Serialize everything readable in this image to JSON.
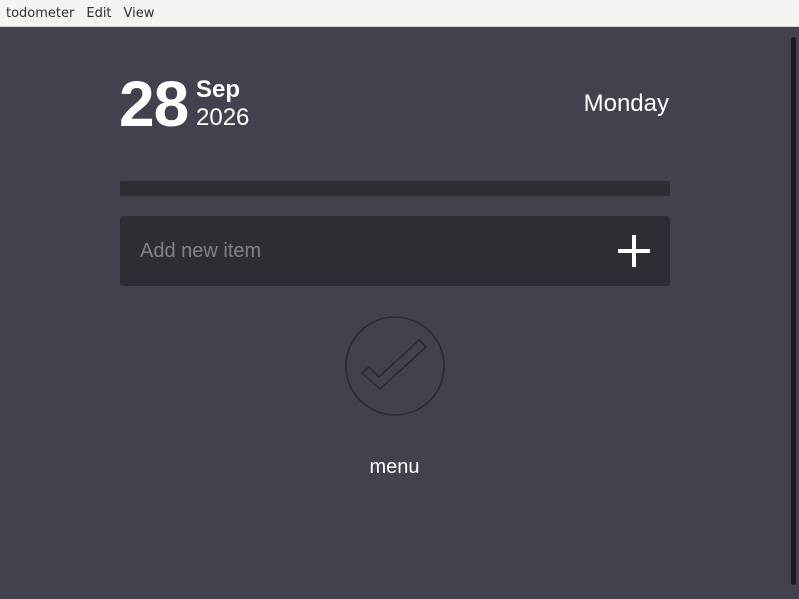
{
  "menubar": {
    "items": [
      "todometer",
      "Edit",
      "View"
    ]
  },
  "date": {
    "day": "28",
    "month": "Sep",
    "year": "2026",
    "weekday": "Monday"
  },
  "progress": {
    "completed_fraction": 0
  },
  "add_item": {
    "placeholder": "Add new item",
    "value": ""
  },
  "footer": {
    "menu_label": "menu"
  },
  "icons": {
    "add": "plus-icon",
    "done": "checkmark-circle-icon"
  },
  "colors": {
    "background": "#42414d",
    "panel": "#2e2d34",
    "text": "#ffffff",
    "placeholder": "#838289",
    "icon_outline": "#2b2a31"
  }
}
